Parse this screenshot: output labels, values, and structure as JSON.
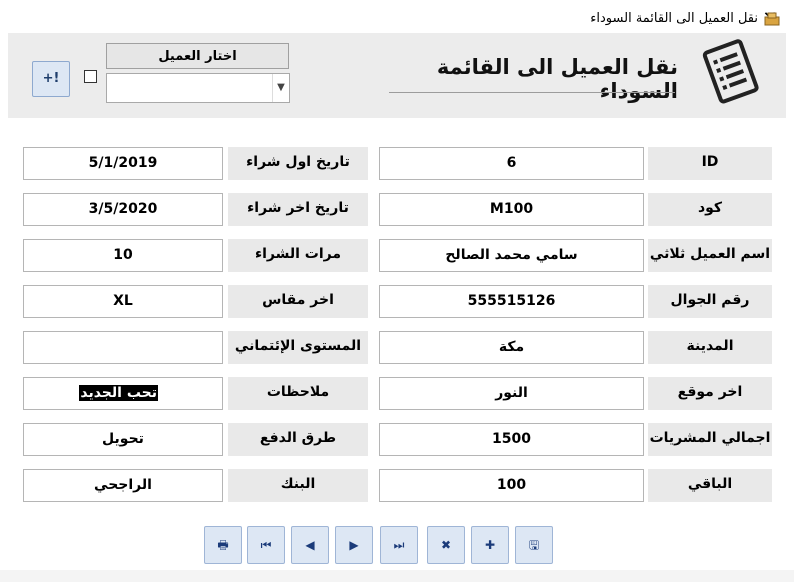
{
  "window": {
    "title": "نقل العميل الى القائمة السوداء",
    "close_glyph": "✕"
  },
  "header": {
    "form_title": "نقل العميل الى القائمة السوداء",
    "choose_client_label": "اختار العميل",
    "client_combo_value": "",
    "add_button_glyph": "+!"
  },
  "right_fields": [
    {
      "label": "ID",
      "value": "6"
    },
    {
      "label": "كود",
      "value": "M100"
    },
    {
      "label": "اسم العميل ثلاثي",
      "value": "سامي محمد الصالح"
    },
    {
      "label": "رقم الجوال",
      "value": "555515126"
    },
    {
      "label": "المدينة",
      "value": "مكة"
    },
    {
      "label": "اخر موقع",
      "value": "النور"
    },
    {
      "label": "اجمالي المشريات",
      "value": "1500"
    },
    {
      "label": "الباقي",
      "value": "100"
    }
  ],
  "left_fields": [
    {
      "label": "تاريخ اول شراء",
      "value": "5/1/2019"
    },
    {
      "label": "تاريخ اخر شراء",
      "value": "3/5/2020"
    },
    {
      "label": "مرات الشراء",
      "value": "10"
    },
    {
      "label": "اخر مقاس",
      "value": "XL"
    },
    {
      "label": "المستوى الإئتماني",
      "value": ""
    },
    {
      "label": "ملاحظات",
      "value": "تحب الجديد"
    },
    {
      "label": "طرق الدفع",
      "value": "تحويل"
    },
    {
      "label": "البنك",
      "value": "الراجحي"
    }
  ],
  "nav_buttons": {
    "print": "🖶",
    "first": "⏮",
    "prev": "◀",
    "next": "▶",
    "last": "⏭",
    "delete": "✖",
    "new": "✚",
    "save": "🖫"
  }
}
